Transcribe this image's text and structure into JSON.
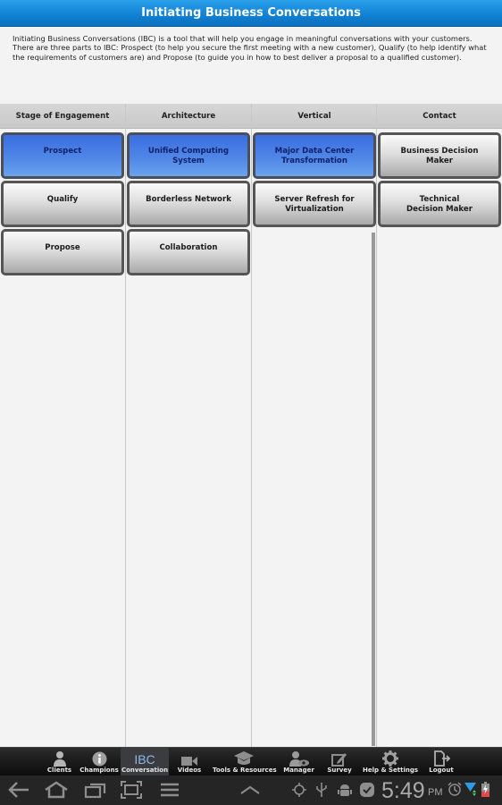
{
  "app": {
    "title": "Initiating Business Conversations",
    "intro": "Initiating Business Conversations (IBC) is a tool that will help you engage in meaningful conversations with your customers. There are three parts to IBC: Prospect (to help you secure the first meeting with a new customer), Qualify (to help identify what the requirements of customers are) and Propose (to guide you in how to best deliver a proposal to a qualified customer)."
  },
  "columns": [
    {
      "header": "Stage of Engagement",
      "items": [
        {
          "label": "Prospect",
          "selected": true
        },
        {
          "label": "Qualify",
          "selected": false
        },
        {
          "label": "Propose",
          "selected": false
        }
      ]
    },
    {
      "header": "Architecture",
      "items": [
        {
          "label": "Unified Computing System",
          "selected": true
        },
        {
          "label": "Borderless Network",
          "selected": false
        },
        {
          "label": "Collaboration",
          "selected": false
        }
      ]
    },
    {
      "header": "Vertical",
      "items": [
        {
          "label": "Major Data Center Transformation",
          "selected": true
        },
        {
          "label": "Server Refresh for Virtualization",
          "selected": false
        }
      ]
    },
    {
      "header": "Contact",
      "items": [
        {
          "label": "Business Decision Maker",
          "selected": false
        },
        {
          "label": "Technical Decision Maker",
          "selected": false
        }
      ]
    }
  ],
  "tabbar": {
    "active": "Conversation",
    "tabs": [
      {
        "label": "Clients",
        "icon": "person-icon"
      },
      {
        "label": "Champions",
        "icon": "info-icon"
      },
      {
        "label": "Conversation",
        "icon": "ibc-icon",
        "icon_text": "IBC"
      },
      {
        "label": "Videos",
        "icon": "video-camera-icon"
      },
      {
        "label": "Tools & Resources",
        "icon": "graduation-cap-icon"
      },
      {
        "label": "Manager",
        "icon": "manager-eye-icon"
      },
      {
        "label": "Survey",
        "icon": "survey-pencil-icon"
      },
      {
        "label": "Help & Settings",
        "icon": "gear-icon"
      },
      {
        "label": "Logout",
        "icon": "logout-icon"
      }
    ]
  },
  "system_bar": {
    "time": "5:49",
    "ampm": "PM",
    "colors": {
      "accent": "#1283d6",
      "selected_item": "#4f86e6"
    }
  }
}
